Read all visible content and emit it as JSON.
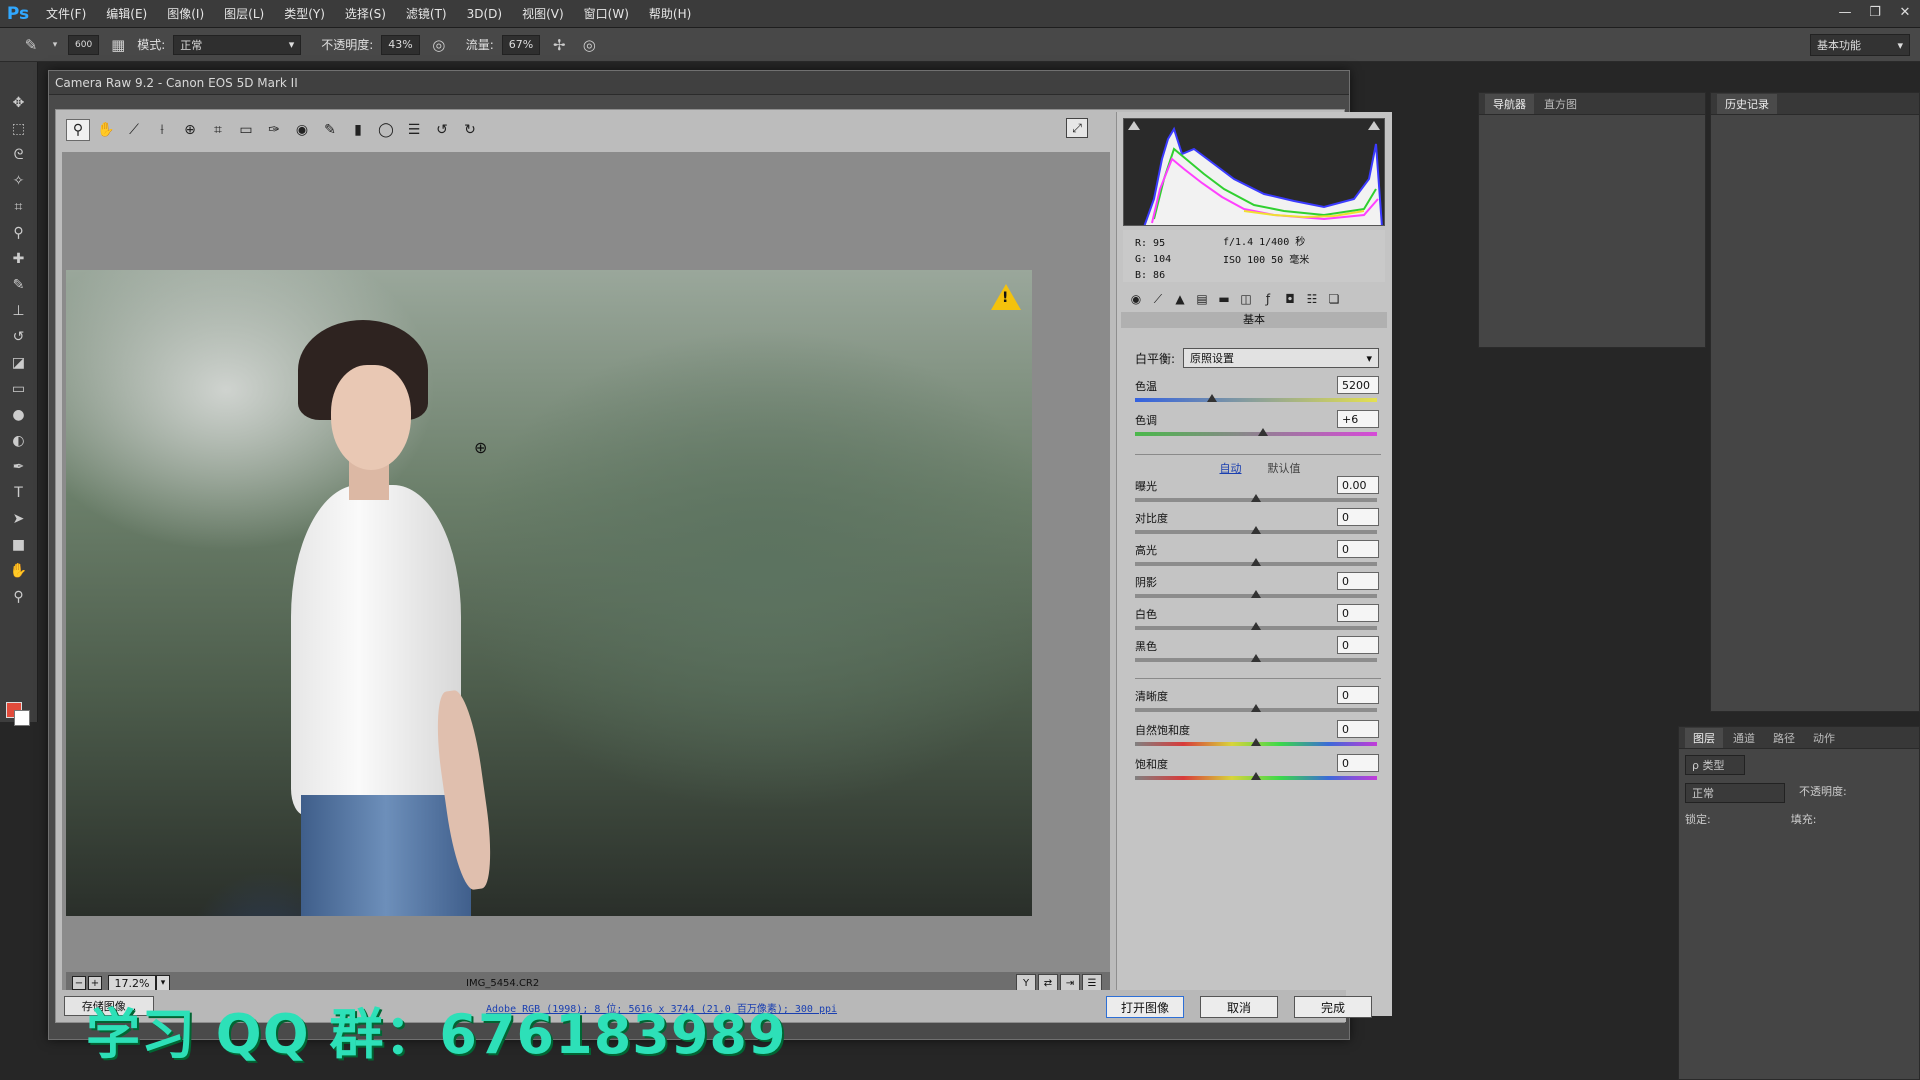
{
  "app": {
    "logo": "Ps",
    "menu": [
      "文件(F)",
      "编辑(E)",
      "图像(I)",
      "图层(L)",
      "类型(Y)",
      "选择(S)",
      "滤镜(T)",
      "3D(D)",
      "视图(V)",
      "窗口(W)",
      "帮助(H)"
    ],
    "window_controls": [
      "—",
      "❐",
      "✕"
    ]
  },
  "options_bar": {
    "brush_size": "600",
    "mode_label": "模式:",
    "mode_value": "正常",
    "opacity_label": "不透明度:",
    "opacity_value": "43%",
    "flow_label": "流量:",
    "flow_value": "67%",
    "workspace": "基本功能"
  },
  "camera_raw": {
    "title": "Camera Raw 9.2 - Canon EOS 5D Mark II",
    "tools": [
      "zoom-icon",
      "hand-icon",
      "white-balance-icon",
      "color-sampler-icon",
      "target-adjust-icon",
      "crop-icon",
      "straighten-icon",
      "spot-removal-icon",
      "red-eye-icon",
      "adjustment-brush-icon",
      "graduated-filter-icon",
      "radial-filter-icon",
      "preferences-icon",
      "rotate-left-icon",
      "rotate-right-icon"
    ],
    "zoom": "17.2%",
    "filename": "IMG_5454.CR2",
    "readout": {
      "r": "R:  95",
      "g": "G:  104",
      "b": "B:  86",
      "exposure": "f/1.4   1/400 秒",
      "iso": "ISO 100   50 毫米"
    },
    "panel_title": "基本",
    "white_balance_label": "白平衡:",
    "white_balance_value": "原照设置",
    "temperature": {
      "label": "色温",
      "value": "5200",
      "pos": 0.32
    },
    "tint": {
      "label": "色调",
      "value": "+6",
      "pos": 0.53
    },
    "auto_label": "自动",
    "default_label": "默认值",
    "tone_sliders": [
      {
        "label": "曝光",
        "value": "0.00",
        "pos": 0.5
      },
      {
        "label": "对比度",
        "value": "0",
        "pos": 0.5
      },
      {
        "label": "高光",
        "value": "0",
        "pos": 0.5
      },
      {
        "label": "阴影",
        "value": "0",
        "pos": 0.5
      },
      {
        "label": "白色",
        "value": "0",
        "pos": 0.5
      },
      {
        "label": "黑色",
        "value": "0",
        "pos": 0.5
      }
    ],
    "presence_sliders": [
      {
        "label": "清晰度",
        "value": "0",
        "pos": 0.5
      },
      {
        "label": "自然饱和度",
        "value": "0",
        "pos": 0.5
      },
      {
        "label": "饱和度",
        "value": "0",
        "pos": 0.5
      }
    ],
    "save_button": "存储图像...",
    "workflow_link": "Adobe RGB (1998); 8 位; 5616 x 3744 (21.0 百万像素); 300 ppi",
    "open_button": "打开图像",
    "cancel_button": "取消",
    "done_button": "完成"
  },
  "ps_panels": {
    "navigator_tabs": [
      "导航器",
      "直方图"
    ],
    "history_tab": "历史记录",
    "layers_tabs": [
      "图层",
      "通道",
      "路径",
      "动作"
    ],
    "layers_filter": "ρ 类型",
    "layers_mode": "正常",
    "layers_opacity_label": "不透明度:",
    "layers_lock_label": "锁定:",
    "layers_fill_label": "填充:"
  },
  "watermark": "学习 QQ 群：676183989",
  "colors": {
    "accent": "#31a8ff",
    "watermark": "#2de0b8",
    "warning": "#f4c20d"
  }
}
